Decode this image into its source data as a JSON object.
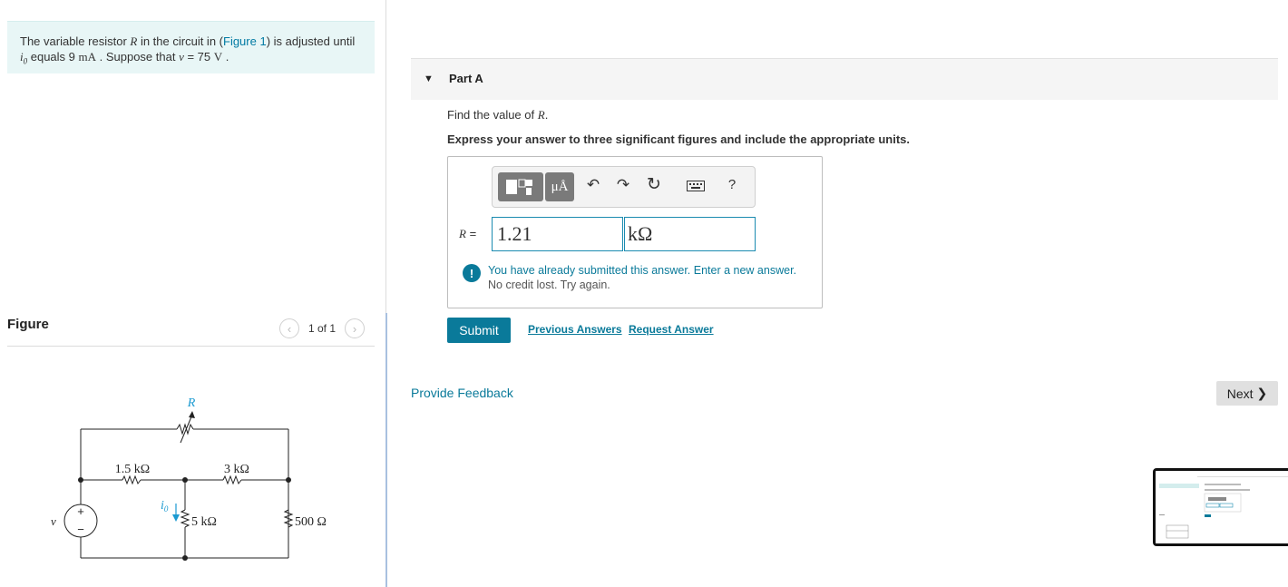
{
  "problem": {
    "prefix": "The variable resistor ",
    "var_R": "R",
    "mid1": " in the circuit in (",
    "figure_link": "Figure 1",
    "mid2": ") is adjusted until",
    "var_i0": "i",
    "i0_sub": "0",
    "mid3": " equals 9 ",
    "unit_mA": "mA",
    "mid4": " . Suppose that ",
    "var_v": "v",
    "mid5": " = 75 ",
    "unit_V": "V",
    "end": " ."
  },
  "figure": {
    "title": "Figure",
    "counter": "1 of 1",
    "prev_icon": "chevron-left-icon",
    "next_icon": "chevron-right-icon",
    "labels": {
      "R": "R",
      "r1": "1.5 kΩ",
      "r2": "3 kΩ",
      "r3": "5 kΩ",
      "r4": "500 Ω",
      "v": "v",
      "i0": "i",
      "i0_sub": "0",
      "plus": "+",
      "minus": "−"
    },
    "highlight_color": "#1b9ad1"
  },
  "part": {
    "caret_icon": "caret-down-icon",
    "label": "Part A",
    "question_prefix": "Find the value of ",
    "question_var": "R",
    "question_suffix": ".",
    "instruction": "Express your answer to three significant figures and include the appropriate units."
  },
  "toolbar": {
    "template_icon": "templates-icon",
    "units_label": "μÅ",
    "undo_icon": "undo-icon",
    "redo_icon": "redo-icon",
    "reset_icon": "reset-icon",
    "keyboard_icon": "keyboard-icon",
    "help_label": "?"
  },
  "answer": {
    "var": "R",
    "eq": " =",
    "value": "1.21",
    "unit": "kΩ"
  },
  "alert": {
    "icon": "!",
    "line1": "You have already submitted this answer. Enter a new answer.",
    "line2": "No credit lost. Try again."
  },
  "actions": {
    "submit": "Submit",
    "previous_answers": "Previous Answers",
    "request_answer": "Request Answer",
    "feedback": "Provide Feedback",
    "next": "Next",
    "next_icon": "chevron-right-icon"
  },
  "colors": {
    "accent": "#0a7a9a",
    "problem_bg": "#e8f6f6"
  }
}
